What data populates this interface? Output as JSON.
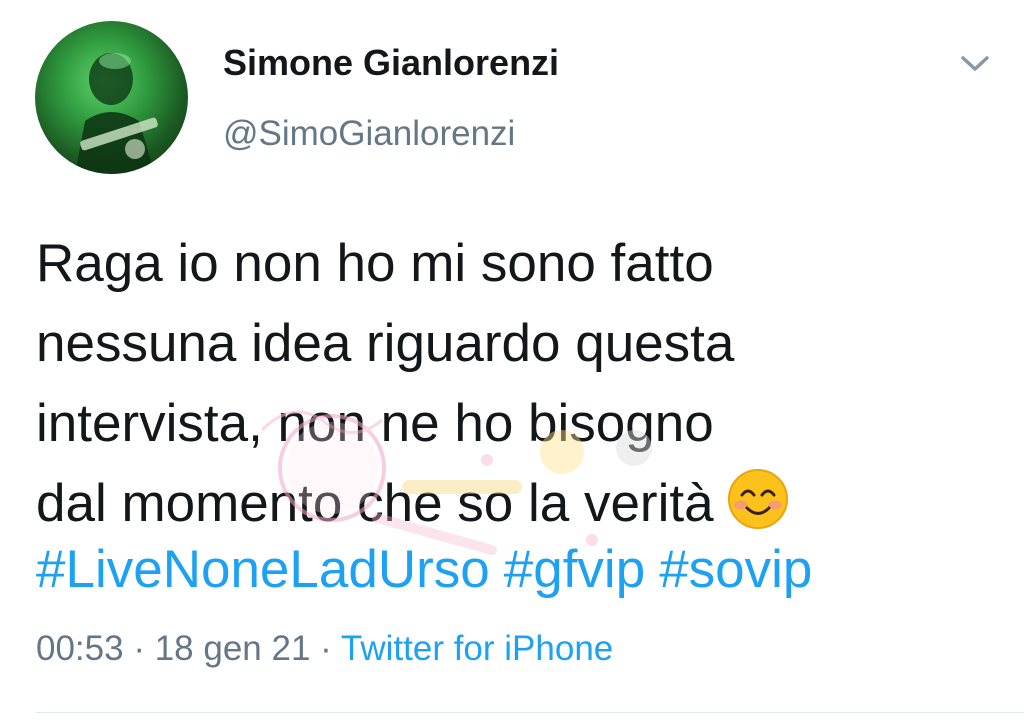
{
  "tweet": {
    "author": {
      "display_name": "Simone Gianlorenzi",
      "handle": "@SimoGianlorenzi"
    },
    "text_lines": [
      "Raga io non ho mi sono fatto",
      "nessuna idea riguardo questa",
      "intervista, non ne ho bisogno",
      "dal momento che so la verità"
    ],
    "emoji": "smiling-face-with-smiling-eyes",
    "hashtags": [
      "#LiveNoneLadUrso",
      "#gfvip",
      "#sovip"
    ],
    "meta": {
      "time": "00:53",
      "separator": " · ",
      "date": "18 gen 21",
      "source": "Twitter for iPhone"
    }
  },
  "colors": {
    "text": "#14171a",
    "secondary": "#657786",
    "link": "#1da1f2"
  }
}
